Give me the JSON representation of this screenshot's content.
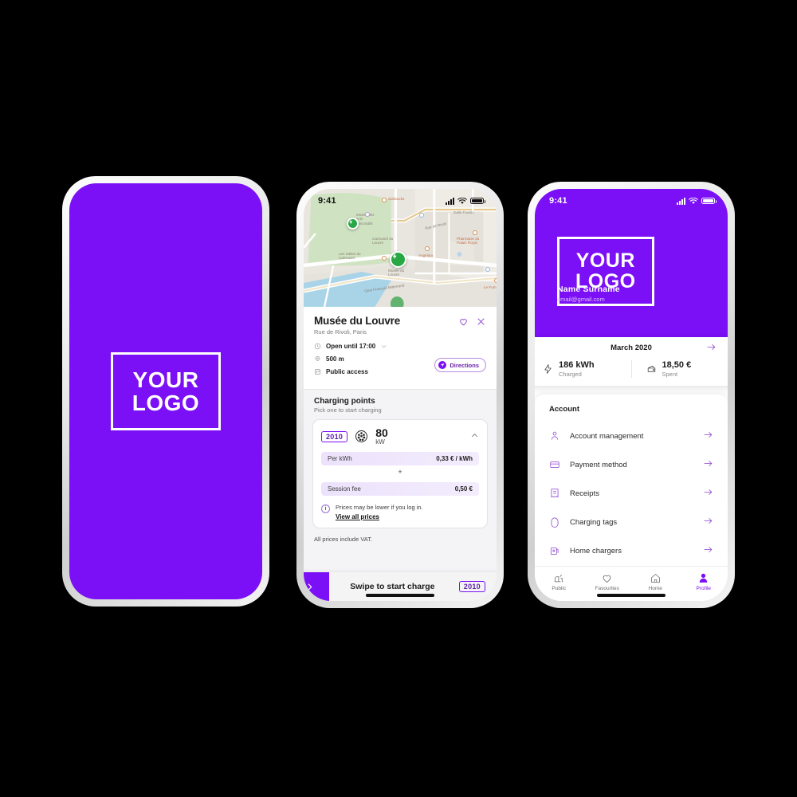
{
  "colors": {
    "brand_purple": "#7b0ff5",
    "accent_violet": "#8b3fd1",
    "pin_green": "#27a844",
    "background": "#000000"
  },
  "phone1": {
    "logo_line1": "YOUR",
    "logo_line2": "LOGO"
  },
  "phone2": {
    "status": {
      "time": "9:41"
    },
    "map": {
      "labels": [
        "Musée des Arts Décoratifs",
        "Carrousel du Louvre",
        "Les Salles du Carrousel",
        "Musée du Louvre",
        "Rue de Rivoli",
        "Quai François Mitterrand",
        "Salle Fourtin"
      ],
      "pois": [
        "Starbucks",
        "Angelina",
        "Pharmacie du Palais Royal",
        "Le Fum"
      ]
    },
    "place": {
      "title": "Musée du Louvre",
      "subtitle": "Rue de Rivoli, Paris",
      "hours": "Open until 17:00",
      "distance": "500 m",
      "access": "Public access",
      "directions_label": "Directions"
    },
    "charging": {
      "section_title": "Charging points",
      "section_subtitle": "Pick one to start charging",
      "point_id": "2010",
      "power_value": "80",
      "power_unit": "kW",
      "per_kwh_label": "Per kWh",
      "per_kwh_value": "0,33 € / kWh",
      "plus": "+",
      "session_fee_label": "Session fee",
      "session_fee_value": "0,50 €",
      "note_text": "Prices may be lower if you log in.",
      "note_link": "View all prices",
      "vat_note": "All prices include VAT."
    },
    "swipe": {
      "label": "Swipe to start charge",
      "badge": "2010"
    }
  },
  "phone3": {
    "status": {
      "time": "9:41"
    },
    "logo_line1": "YOUR",
    "logo_line2": "LOGO",
    "user": {
      "name": "Name Surname",
      "email": "email@gmail.com"
    },
    "stats": {
      "month": "March 2020",
      "charged_value": "186 kWh",
      "charged_label": "Charged",
      "spent_value": "18,50 €",
      "spent_label": "Spent"
    },
    "account": {
      "title": "Account",
      "items": [
        {
          "label": "Account management",
          "icon": "person-icon"
        },
        {
          "label": "Payment method",
          "icon": "card-icon"
        },
        {
          "label": "Receipts",
          "icon": "receipt-icon"
        },
        {
          "label": "Charging tags",
          "icon": "tag-icon"
        },
        {
          "label": "Home chargers",
          "icon": "home-charger-icon"
        }
      ]
    },
    "tabs": [
      {
        "label": "Public",
        "icon": "charger-icon",
        "active": false
      },
      {
        "label": "Favourites",
        "icon": "heart-icon",
        "active": false
      },
      {
        "label": "Home",
        "icon": "home-icon",
        "active": false
      },
      {
        "label": "Profile",
        "icon": "profile-icon",
        "active": true
      }
    ]
  }
}
